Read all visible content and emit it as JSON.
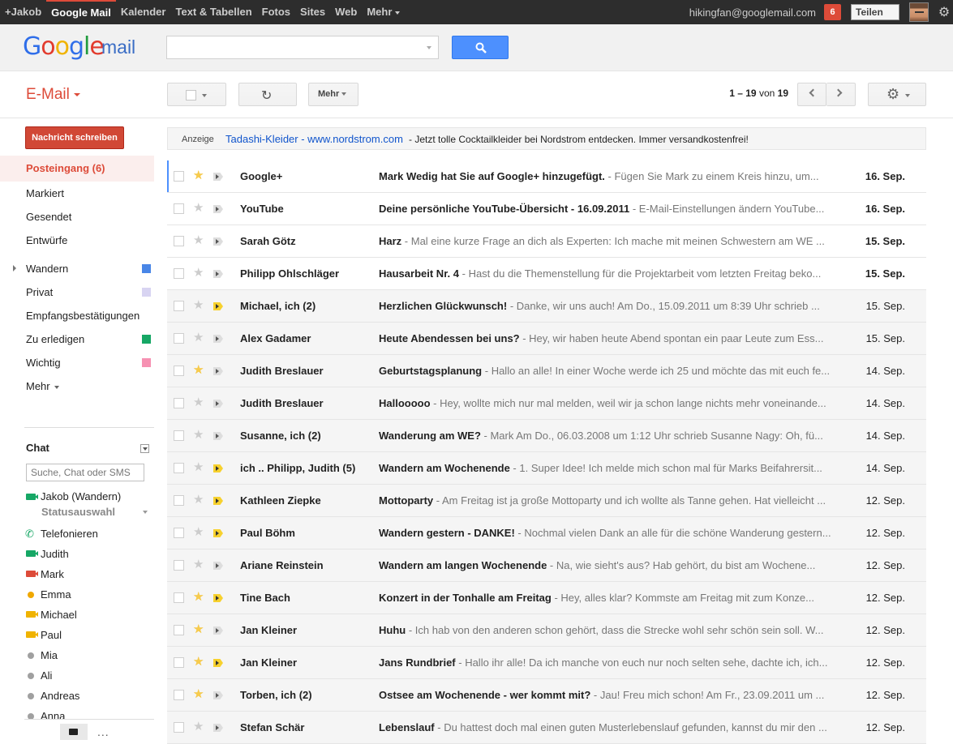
{
  "topbar": {
    "nav": [
      "+Jakob",
      "Google Mail",
      "Kalender",
      "Text & Tabellen",
      "Fotos",
      "Sites",
      "Web",
      "Mehr"
    ],
    "active_index": 1,
    "account_email": "hikingfan@googlemail.com",
    "notification_count": "6",
    "share_label": "Teilen"
  },
  "header": {
    "logo": {
      "g1": "G",
      "g2": "o",
      "g3": "o",
      "g4": "g",
      "g5": "l",
      "g6": "e",
      "product": "mail"
    },
    "search_value": "",
    "search_placeholder": ""
  },
  "toolbar": {
    "mail_label": "E-Mail",
    "more_label": "Mehr",
    "pagination": {
      "from": "1",
      "to": "19",
      "of_label": "von",
      "total": "19"
    }
  },
  "compose_label": "Nachricht schreiben",
  "folders": [
    {
      "label": "Posteingang (6)",
      "active": true
    },
    {
      "label": "Markiert"
    },
    {
      "label": "Gesendet"
    },
    {
      "label": "Entwürfe"
    },
    {
      "label": "Wandern",
      "color": "#4986e7",
      "expand": true
    },
    {
      "label": "Privat",
      "color": "#d8d4f2"
    },
    {
      "label": "Empfangsbestätigungen"
    },
    {
      "label": "Zu erledigen",
      "color": "#16a765"
    },
    {
      "label": "Wichtig",
      "color": "#f691b2"
    },
    {
      "label": "Mehr",
      "caret": true
    }
  ],
  "chat": {
    "title": "Chat",
    "search_placeholder": "Suche, Chat oder SMS",
    "self_name": "Jakob (Wandern)",
    "self_status": "Statusauswahl",
    "contacts": [
      {
        "name": "Telefonieren",
        "icon": "phone-icon",
        "color": "#16a765"
      },
      {
        "name": "Judith",
        "icon": "video-icon",
        "color": "#16a765"
      },
      {
        "name": "Mark",
        "icon": "video-icon",
        "color": "#dd4b39"
      },
      {
        "name": "Emma",
        "icon": "idle-icon",
        "color": "#f0a800"
      },
      {
        "name": "Michael",
        "icon": "video-icon",
        "color": "#f0b300"
      },
      {
        "name": "Paul",
        "icon": "video-icon",
        "color": "#f0b300"
      },
      {
        "name": "Mia",
        "icon": "offline-icon",
        "color": "#a0a0a0"
      },
      {
        "name": "Ali",
        "icon": "offline-icon",
        "color": "#a0a0a0"
      },
      {
        "name": "Andreas",
        "icon": "offline-icon",
        "color": "#a0a0a0"
      },
      {
        "name": "Anna",
        "icon": "offline-icon",
        "color": "#a0a0a0"
      }
    ],
    "more_label": "..."
  },
  "ad": {
    "label": "Anzeige",
    "link": "Tadashi-Kleider - www.nordstrom.com",
    "text": "- Jetzt tolle Cocktailkleider bei Nordstrom entdecken. Immer versandkostenfrei!"
  },
  "messages": [
    {
      "sender": "Google+",
      "subject": "Mark Wedig hat Sie auf Google+ hinzugefügt.",
      "snippet": "Fügen Sie Mark zu einem Kreis hinzu, um...",
      "date": "16. Sep.",
      "unread": true,
      "starred": true,
      "important": false
    },
    {
      "sender": "YouTube",
      "subject": "Deine persönliche YouTube-Übersicht - 16.09.2011",
      "snippet": "E-Mail-Einstellungen ändern YouTube...",
      "date": "16. Sep.",
      "unread": true,
      "starred": false,
      "important": false
    },
    {
      "sender": "Sarah Götz",
      "subject": "Harz",
      "snippet": "Mal eine kurze Frage an dich als Experten: Ich mache mit meinen Schwestern am WE ...",
      "date": "15. Sep.",
      "unread": true,
      "starred": false,
      "important": false
    },
    {
      "sender": "Philipp Ohlschläger",
      "subject": "Hausarbeit Nr. 4",
      "snippet": "Hast du die Themenstellung für die Projektarbeit vom letzten Freitag beko...",
      "date": "15. Sep.",
      "unread": true,
      "starred": false,
      "important": false
    },
    {
      "sender": "Michael, ich (2)",
      "subject": "Herzlichen Glückwunsch!",
      "snippet": "Danke, wir uns auch! Am Do., 15.09.2011 um 8:39 Uhr schrieb ...",
      "date": "15. Sep.",
      "unread": false,
      "starred": false,
      "important": true
    },
    {
      "sender": "Alex Gadamer",
      "subject": "Heute Abendessen bei uns?",
      "snippet": "Hey, wir haben heute Abend spontan ein paar Leute zum Ess...",
      "date": "15. Sep.",
      "unread": false,
      "starred": false,
      "important": false
    },
    {
      "sender": "Judith Breslauer",
      "subject": "Geburtstagsplanung",
      "snippet": "Hallo an alle! In einer Woche werde ich 25 und möchte das mit euch fe...",
      "date": "14. Sep.",
      "unread": false,
      "starred": true,
      "important": false
    },
    {
      "sender": "Judith Breslauer",
      "subject": "Hallooooo",
      "snippet": "Hey, wollte mich nur mal melden, weil wir ja schon lange nichts mehr voneinande...",
      "date": "14. Sep.",
      "unread": false,
      "starred": false,
      "important": false
    },
    {
      "sender": "Susanne, ich (2)",
      "subject": "Wanderung am WE?",
      "snippet": "Mark Am Do., 06.03.2008 um 1:12 Uhr schrieb Susanne Nagy: Oh, fü...",
      "date": "14. Sep.",
      "unread": false,
      "starred": false,
      "important": false
    },
    {
      "sender": "ich .. Philipp, Judith (5)",
      "subject": "Wandern am Wochenende",
      "snippet": "1. Super Idee! Ich melde mich schon mal für Marks Beifahrersit...",
      "date": "14. Sep.",
      "unread": false,
      "starred": false,
      "important": true
    },
    {
      "sender": "Kathleen Ziepke",
      "subject": "Mottoparty",
      "snippet": "Am Freitag ist ja große Mottoparty und ich wollte als Tanne gehen. Hat vielleicht ...",
      "date": "12. Sep.",
      "unread": false,
      "starred": false,
      "important": true
    },
    {
      "sender": "Paul Böhm",
      "subject": "Wandern gestern - DANKE!",
      "snippet": "Nochmal vielen Dank an alle für die schöne Wanderung gestern...",
      "date": "12. Sep.",
      "unread": false,
      "starred": false,
      "important": true
    },
    {
      "sender": "Ariane Reinstein",
      "subject": "Wandern am langen Wochenende",
      "snippet": "Na, wie sieht's aus? Hab gehört, du bist am Wochene...",
      "date": "12. Sep.",
      "unread": false,
      "starred": false,
      "important": false
    },
    {
      "sender": "Tine Bach",
      "subject": "Konzert in der Tonhalle am Freitag",
      "snippet": "Hey, alles klar? Kommste am Freitag mit zum Konze...",
      "date": "12. Sep.",
      "unread": false,
      "starred": true,
      "important": true
    },
    {
      "sender": "Jan Kleiner",
      "subject": "Huhu",
      "snippet": "Ich hab von den anderen schon gehört, dass die Strecke wohl sehr schön sein soll. W...",
      "date": "12. Sep.",
      "unread": false,
      "starred": true,
      "important": false
    },
    {
      "sender": "Jan Kleiner",
      "subject": "Jans Rundbrief",
      "snippet": "Hallo ihr alle! Da ich manche von euch nur noch selten sehe, dachte ich, ich...",
      "date": "12. Sep.",
      "unread": false,
      "starred": true,
      "important": true
    },
    {
      "sender": "Torben, ich (2)",
      "subject": "Ostsee am Wochenende - wer kommt mit?",
      "snippet": "Jau! Freu mich schon! Am Fr., 23.09.2011 um ...",
      "date": "12. Sep.",
      "unread": false,
      "starred": true,
      "important": false
    },
    {
      "sender": "Stefan Schär",
      "subject": "Lebenslauf",
      "snippet": "Du hattest doch mal einen guten Musterlebenslauf gefunden, kannst du mir den ...",
      "date": "12. Sep.",
      "unread": false,
      "starred": false,
      "important": false
    }
  ]
}
